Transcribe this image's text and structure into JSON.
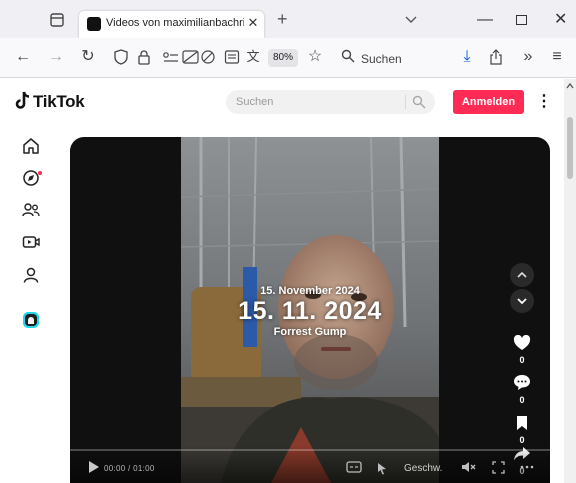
{
  "browser": {
    "tab": {
      "title": "Videos von maximilianbachring"
    },
    "zoom": "80%",
    "search_label": "Suchen"
  },
  "site": {
    "logo_text": "TikTok",
    "search_placeholder": "Suchen",
    "login_label": "Anmelden",
    "more_label": "⋮",
    "brand_color": "#fe2c55"
  },
  "sidebar": {
    "items": [
      {
        "icon": "home-icon"
      },
      {
        "icon": "explore-icon",
        "has_notification_dot": true
      },
      {
        "icon": "following-icon"
      },
      {
        "icon": "live-icon"
      },
      {
        "icon": "profile-icon"
      },
      {
        "icon": "friends-avatar-icon"
      }
    ]
  },
  "video": {
    "overlay_date_small": "15. November 2024",
    "overlay_date_big": "15. 11. 2024",
    "overlay_subtitle": "Forrest Gump",
    "actions": {
      "likes": "0",
      "comments": "0",
      "saves": "0",
      "shares": "0"
    },
    "controls": {
      "time": "00:00 / 01:00",
      "speed_label": "Geschw."
    }
  }
}
